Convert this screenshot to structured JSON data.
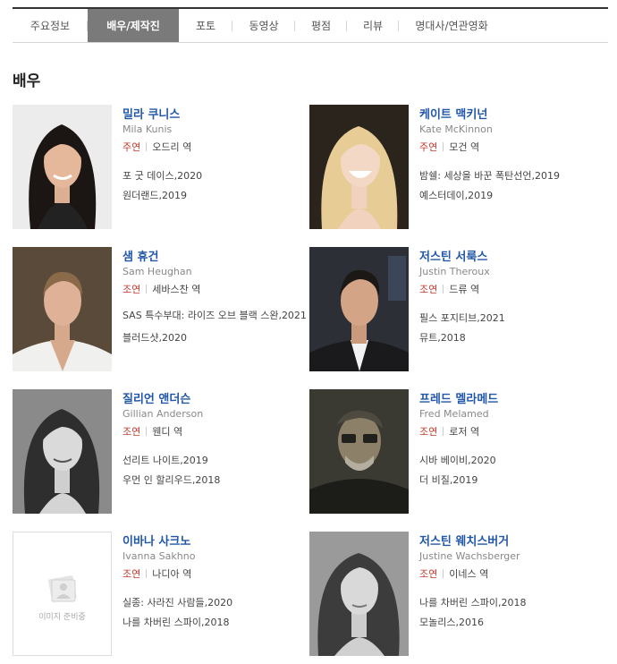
{
  "tabs": [
    "주요정보",
    "배우/제작진",
    "포토",
    "동영상",
    "평점",
    "리뷰",
    "명대사/연관영화"
  ],
  "active_tab": 1,
  "section_title": "배우",
  "no_image_text": "이미지 준비중",
  "cast": [
    {
      "name_ko": "밀라 쿠니스",
      "name_en": "Mila Kunis",
      "role_type": "주연",
      "role_name": "오드리 역",
      "works": [
        "포 굿 데이스,2020",
        "원더랜드,2019"
      ]
    },
    {
      "name_ko": "케이트 맥키넌",
      "name_en": "Kate McKinnon",
      "role_type": "주연",
      "role_name": "모건 역",
      "works": [
        "밤쉘: 세상을 바꾼 폭탄선언,2019",
        "예스터데이,2019"
      ]
    },
    {
      "name_ko": "샘 휴건",
      "name_en": "Sam Heughan",
      "role_type": "조연",
      "role_name": "세바스찬 역",
      "works": [
        "SAS 특수부대: 라이즈 오브 블랙 스완,2021",
        "블러드샷,2020"
      ]
    },
    {
      "name_ko": "저스틴 서룩스",
      "name_en": "Justin Theroux",
      "role_type": "조연",
      "role_name": "드류 역",
      "works": [
        "필스 포지티브,2021",
        "뮤트,2018"
      ]
    },
    {
      "name_ko": "질리언 앤더슨",
      "name_en": "Gillian Anderson",
      "role_type": "조연",
      "role_name": "웬디 역",
      "works": [
        "선리트 나이트,2019",
        "우먼 인 할리우드,2018"
      ]
    },
    {
      "name_ko": "프레드 멜라메드",
      "name_en": "Fred Melamed",
      "role_type": "조연",
      "role_name": "로저 역",
      "works": [
        "시바 베이비,2020",
        "더 비질,2019"
      ]
    },
    {
      "name_ko": "이바나 사크노",
      "name_en": "Ivanna Sakhno",
      "role_type": "조연",
      "role_name": "나디아 역",
      "works": [
        "실종: 사라진 사람들,2020",
        "나를 차버린 스파이,2018"
      ]
    },
    {
      "name_ko": "저스틴 웨치스버거",
      "name_en": "Justine Wachsberger",
      "role_type": "조연",
      "role_name": "이네스 역",
      "works": [
        "나를 차버린 스파이,2018",
        "모놀리스,2016"
      ]
    }
  ]
}
